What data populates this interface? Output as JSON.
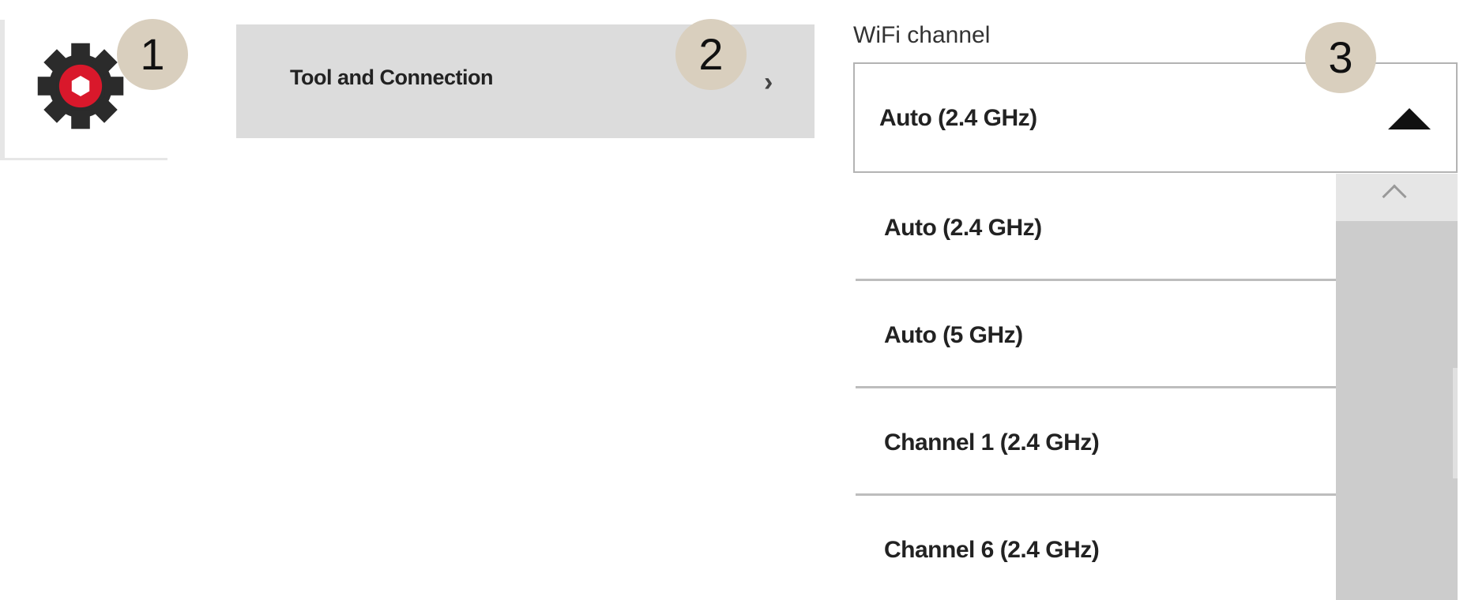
{
  "callouts": [
    "1",
    "2",
    "3"
  ],
  "settings": {
    "icon": "gear-icon",
    "colors": {
      "gear": "#2b2b2b",
      "center": "#d9182b"
    }
  },
  "menu": {
    "item_label": "Tool and Connection",
    "chevron_icon": "chevron-right-icon"
  },
  "wifi_channel": {
    "label": "WiFi channel",
    "selected_value": "Auto (2.4 GHz)",
    "caret_icon": "caret-up-icon",
    "options": [
      "Auto (2.4 GHz)",
      "Auto (5 GHz)",
      "Channel 1 (2.4 GHz)",
      "Channel 6 (2.4 GHz)"
    ]
  },
  "colors": {
    "badge": "#d9cfbe",
    "menu_background": "#dcdcdc",
    "scrollbar": "#cccccc"
  }
}
